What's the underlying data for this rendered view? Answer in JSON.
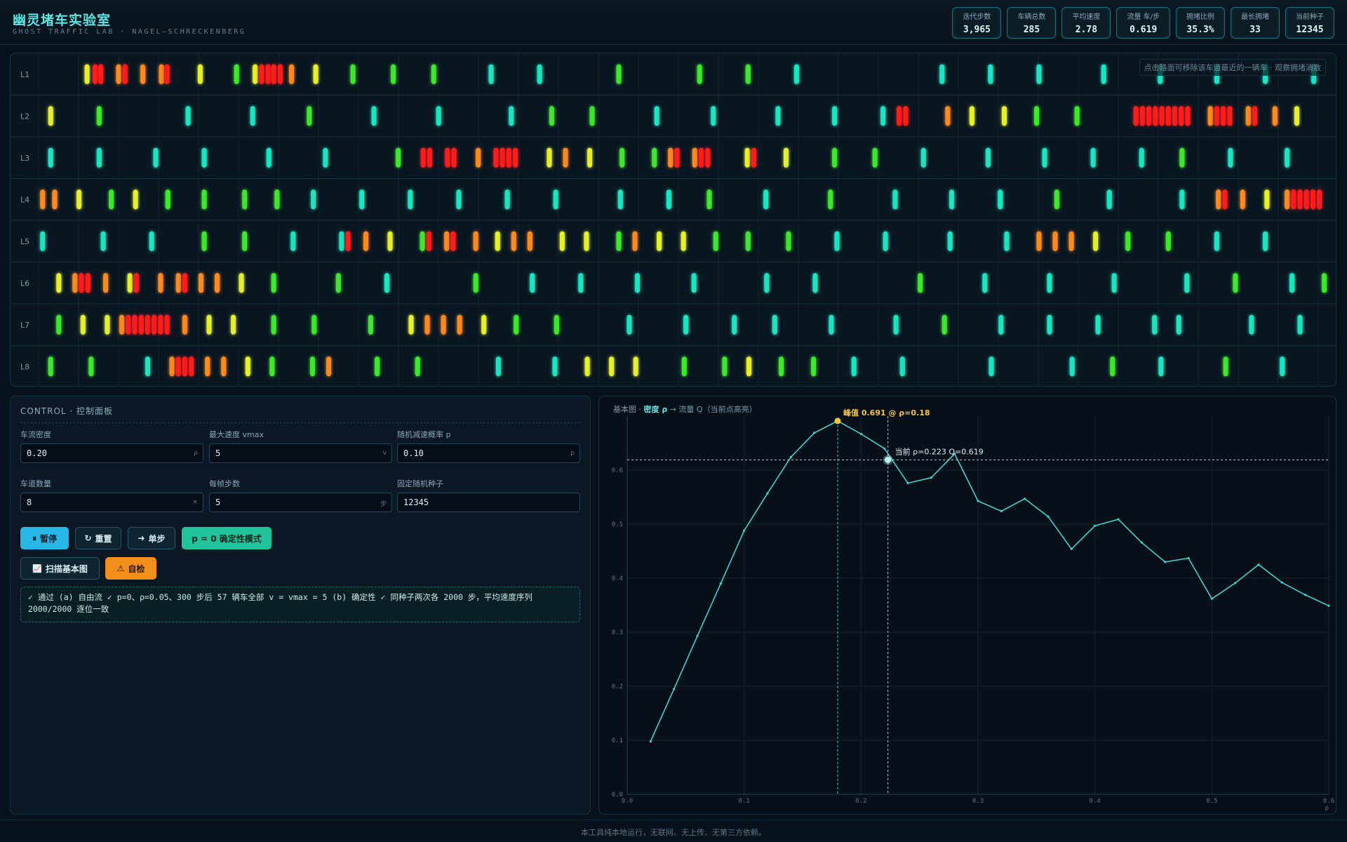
{
  "header": {
    "title": "幽灵堵车实验室",
    "subtitle": "GHOST TRAFFIC LAB · NAGEL–SCHRECKENBERG"
  },
  "stats": [
    {
      "label": "迭代步数",
      "value": "3,965"
    },
    {
      "label": "车辆总数",
      "value": "285"
    },
    {
      "label": "平均速度",
      "value": "2.78"
    },
    {
      "label": "流量 车/步",
      "value": "0.619"
    },
    {
      "label": "拥堵比例",
      "value": "35.3%"
    },
    {
      "label": "最长拥堵",
      "value": "33"
    },
    {
      "label": "当前种子",
      "value": "12345"
    }
  ],
  "road": {
    "hint": "点击路面可移除该车道最近的一辆车 · 观察拥堵消散",
    "lane_labels": [
      "L1",
      "L2",
      "L3",
      "L4",
      "L5",
      "L6",
      "L7",
      "L8"
    ],
    "speed_colors": [
      "#ff1f1f",
      "#ff8a1a",
      "#e6f026",
      "#3de82a",
      "#19e6c1"
    ],
    "cars": [
      [
        [
          60,
          2
        ],
        [
          70,
          0
        ],
        [
          77,
          0
        ],
        [
          99,
          1
        ],
        [
          107,
          0
        ],
        [
          129,
          1
        ],
        [
          152,
          1
        ],
        [
          159,
          0
        ],
        [
          200,
          2
        ],
        [
          245,
          3
        ],
        [
          268,
          2
        ],
        [
          276,
          0
        ],
        [
          284,
          0
        ],
        [
          291,
          0
        ],
        [
          299,
          0
        ],
        [
          313,
          1
        ],
        [
          343,
          2
        ],
        [
          389,
          3
        ],
        [
          439,
          3
        ],
        [
          489,
          3
        ],
        [
          560,
          4
        ],
        [
          620,
          4
        ],
        [
          718,
          3
        ],
        [
          818,
          3
        ],
        [
          878,
          3
        ],
        [
          938,
          4
        ],
        [
          1118,
          4
        ],
        [
          1178,
          4
        ],
        [
          1238,
          4
        ],
        [
          1318,
          4
        ],
        [
          1388,
          4
        ],
        [
          1458,
          4
        ],
        [
          1518,
          4
        ],
        [
          1578,
          4
        ]
      ],
      [
        [
          15,
          2
        ],
        [
          75,
          3
        ],
        [
          185,
          4
        ],
        [
          265,
          4
        ],
        [
          335,
          3
        ],
        [
          415,
          4
        ],
        [
          495,
          4
        ],
        [
          585,
          4
        ],
        [
          635,
          3
        ],
        [
          685,
          3
        ],
        [
          765,
          4
        ],
        [
          835,
          4
        ],
        [
          915,
          4
        ],
        [
          985,
          4
        ],
        [
          1045,
          4
        ],
        [
          1065,
          0
        ],
        [
          1073,
          0
        ],
        [
          1125,
          1
        ],
        [
          1155,
          2
        ],
        [
          1195,
          2
        ],
        [
          1235,
          3
        ],
        [
          1285,
          3
        ],
        [
          1358,
          0
        ],
        [
          1366,
          0
        ],
        [
          1374,
          0
        ],
        [
          1382,
          0
        ],
        [
          1390,
          0
        ],
        [
          1398,
          0
        ],
        [
          1406,
          0
        ],
        [
          1414,
          0
        ],
        [
          1422,
          0
        ],
        [
          1450,
          1
        ],
        [
          1458,
          0
        ],
        [
          1466,
          0
        ],
        [
          1474,
          0
        ],
        [
          1497,
          1
        ],
        [
          1505,
          0
        ],
        [
          1530,
          1
        ],
        [
          1557,
          2
        ]
      ],
      [
        [
          15,
          4
        ],
        [
          75,
          4
        ],
        [
          145,
          4
        ],
        [
          205,
          4
        ],
        [
          285,
          4
        ],
        [
          355,
          4
        ],
        [
          445,
          3
        ],
        [
          476,
          0
        ],
        [
          484,
          0
        ],
        [
          506,
          0
        ],
        [
          514,
          0
        ],
        [
          544,
          1
        ],
        [
          566,
          0
        ],
        [
          574,
          0
        ],
        [
          582,
          0
        ],
        [
          590,
          0
        ],
        [
          632,
          2
        ],
        [
          652,
          1
        ],
        [
          682,
          2
        ],
        [
          722,
          3
        ],
        [
          762,
          3
        ],
        [
          782,
          1
        ],
        [
          790,
          0
        ],
        [
          812,
          1
        ],
        [
          820,
          0
        ],
        [
          828,
          0
        ],
        [
          877,
          2
        ],
        [
          885,
          0
        ],
        [
          925,
          2
        ],
        [
          985,
          3
        ],
        [
          1035,
          3
        ],
        [
          1095,
          4
        ],
        [
          1175,
          4
        ],
        [
          1245,
          4
        ],
        [
          1305,
          4
        ],
        [
          1365,
          4
        ],
        [
          1415,
          3
        ],
        [
          1475,
          4
        ],
        [
          1545,
          4
        ]
      ],
      [
        [
          5,
          1
        ],
        [
          20,
          1
        ],
        [
          50,
          2
        ],
        [
          90,
          3
        ],
        [
          120,
          2
        ],
        [
          160,
          3
        ],
        [
          205,
          3
        ],
        [
          255,
          3
        ],
        [
          295,
          3
        ],
        [
          340,
          4
        ],
        [
          400,
          4
        ],
        [
          460,
          4
        ],
        [
          520,
          4
        ],
        [
          580,
          4
        ],
        [
          640,
          4
        ],
        [
          720,
          4
        ],
        [
          780,
          4
        ],
        [
          830,
          3
        ],
        [
          900,
          4
        ],
        [
          980,
          3
        ],
        [
          1060,
          4
        ],
        [
          1130,
          4
        ],
        [
          1190,
          4
        ],
        [
          1260,
          3
        ],
        [
          1325,
          4
        ],
        [
          1415,
          4
        ],
        [
          1460,
          1
        ],
        [
          1468,
          0
        ],
        [
          1490,
          1
        ],
        [
          1520,
          2
        ],
        [
          1545,
          1
        ],
        [
          1553,
          0
        ],
        [
          1561,
          0
        ],
        [
          1569,
          0
        ],
        [
          1577,
          0
        ],
        [
          1585,
          0
        ]
      ],
      [
        [
          5,
          4
        ],
        [
          80,
          4
        ],
        [
          140,
          4
        ],
        [
          205,
          3
        ],
        [
          255,
          3
        ],
        [
          315,
          4
        ],
        [
          375,
          4
        ],
        [
          383,
          0
        ],
        [
          405,
          1
        ],
        [
          435,
          2
        ],
        [
          475,
          3
        ],
        [
          483,
          0
        ],
        [
          505,
          1
        ],
        [
          513,
          0
        ],
        [
          541,
          1
        ],
        [
          568,
          2
        ],
        [
          588,
          1
        ],
        [
          608,
          1
        ],
        [
          648,
          2
        ],
        [
          678,
          2
        ],
        [
          718,
          3
        ],
        [
          738,
          1
        ],
        [
          768,
          2
        ],
        [
          798,
          2
        ],
        [
          838,
          3
        ],
        [
          878,
          3
        ],
        [
          928,
          3
        ],
        [
          988,
          4
        ],
        [
          1048,
          4
        ],
        [
          1128,
          4
        ],
        [
          1198,
          4
        ],
        [
          1238,
          1
        ],
        [
          1258,
          1
        ],
        [
          1278,
          1
        ],
        [
          1308,
          2
        ],
        [
          1348,
          3
        ],
        [
          1398,
          3
        ],
        [
          1458,
          4
        ],
        [
          1518,
          4
        ]
      ],
      [
        [
          25,
          2
        ],
        [
          45,
          1
        ],
        [
          53,
          0
        ],
        [
          61,
          0
        ],
        [
          83,
          1
        ],
        [
          113,
          2
        ],
        [
          121,
          0
        ],
        [
          151,
          1
        ],
        [
          173,
          1
        ],
        [
          181,
          0
        ],
        [
          201,
          1
        ],
        [
          221,
          1
        ],
        [
          251,
          2
        ],
        [
          291,
          3
        ],
        [
          371,
          3
        ],
        [
          431,
          4
        ],
        [
          541,
          3
        ],
        [
          611,
          4
        ],
        [
          671,
          4
        ],
        [
          741,
          4
        ],
        [
          811,
          4
        ],
        [
          901,
          4
        ],
        [
          961,
          4
        ],
        [
          1091,
          3
        ],
        [
          1171,
          4
        ],
        [
          1251,
          4
        ],
        [
          1331,
          4
        ],
        [
          1421,
          4
        ],
        [
          1481,
          3
        ],
        [
          1551,
          4
        ],
        [
          1591,
          3
        ]
      ],
      [
        [
          25,
          3
        ],
        [
          55,
          2
        ],
        [
          85,
          2
        ],
        [
          103,
          1
        ],
        [
          111,
          0
        ],
        [
          119,
          0
        ],
        [
          127,
          0
        ],
        [
          135,
          0
        ],
        [
          143,
          0
        ],
        [
          151,
          0
        ],
        [
          159,
          0
        ],
        [
          181,
          1
        ],
        [
          211,
          2
        ],
        [
          241,
          2
        ],
        [
          291,
          3
        ],
        [
          341,
          3
        ],
        [
          411,
          3
        ],
        [
          461,
          2
        ],
        [
          481,
          1
        ],
        [
          501,
          1
        ],
        [
          521,
          1
        ],
        [
          551,
          2
        ],
        [
          591,
          3
        ],
        [
          641,
          3
        ],
        [
          731,
          4
        ],
        [
          801,
          4
        ],
        [
          861,
          4
        ],
        [
          911,
          4
        ],
        [
          981,
          4
        ],
        [
          1061,
          4
        ],
        [
          1121,
          3
        ],
        [
          1191,
          4
        ],
        [
          1251,
          4
        ],
        [
          1311,
          4
        ],
        [
          1381,
          4
        ],
        [
          1411,
          4
        ],
        [
          1501,
          4
        ],
        [
          1561,
          4
        ]
      ],
      [
        [
          15,
          3
        ],
        [
          65,
          3
        ],
        [
          135,
          4
        ],
        [
          165,
          1
        ],
        [
          173,
          0
        ],
        [
          181,
          0
        ],
        [
          189,
          0
        ],
        [
          209,
          1
        ],
        [
          229,
          1
        ],
        [
          259,
          2
        ],
        [
          289,
          3
        ],
        [
          339,
          3
        ],
        [
          359,
          1
        ],
        [
          419,
          3
        ],
        [
          469,
          3
        ],
        [
          569,
          4
        ],
        [
          639,
          4
        ],
        [
          679,
          2
        ],
        [
          709,
          2
        ],
        [
          739,
          2
        ],
        [
          799,
          3
        ],
        [
          849,
          3
        ],
        [
          879,
          2
        ],
        [
          919,
          3
        ],
        [
          959,
          3
        ],
        [
          1009,
          4
        ],
        [
          1069,
          4
        ],
        [
          1179,
          4
        ],
        [
          1279,
          4
        ],
        [
          1329,
          3
        ],
        [
          1389,
          4
        ],
        [
          1469,
          3
        ],
        [
          1539,
          4
        ]
      ]
    ]
  },
  "controls": {
    "panel_title": "CONTROL · 控制面板",
    "fields": [
      {
        "label": "车流密度",
        "value": "0.20",
        "unit": "ρ"
      },
      {
        "label": "最大速度 vmax",
        "value": "5",
        "unit": "v"
      },
      {
        "label": "随机减速概率 p",
        "value": "0.10",
        "unit": "p"
      },
      {
        "label": "车道数量",
        "value": "8",
        "unit": "×"
      },
      {
        "label": "每帧步数",
        "value": "5",
        "unit": "步"
      },
      {
        "label": "固定随机种子",
        "value": "12345",
        "unit": ""
      }
    ],
    "buttons": {
      "pause": "暂停",
      "pause_icon": "⏸",
      "reset": "重置",
      "reset_icon": "↻",
      "step": "单步",
      "step_icon": "➜",
      "deterministic": "p = 0 确定性模式",
      "sweep": "扫描基本图",
      "sweep_icon": "📈",
      "selfcheck": "自检",
      "selfcheck_icon": "⚠"
    },
    "result_text": "✓ 通过 (a) 自由流 ✓ p=0、ρ=0.05、300 步后 57 辆车全部 v = vmax = 5 (b) 确定性 ✓ 同种子两次各 2000 步，平均速度序列 2000/2000 逐位一致"
  },
  "chart_data": {
    "type": "line",
    "title_prefix": "基本图 · ",
    "title_bold": "密度 ρ",
    "title_suffix": " → 流量 Q（当前点高亮）",
    "xlabel": "ρ",
    "xlim": [
      0,
      0.6
    ],
    "ylim": [
      0,
      0.7
    ],
    "xticks": [
      "0.0",
      "0.1",
      "0.2",
      "0.3",
      "0.4",
      "0.5",
      "0.6"
    ],
    "yticks": [
      "0.0",
      "0.1",
      "0.2",
      "0.3",
      "0.4",
      "0.5",
      "0.6"
    ],
    "x": [
      0.02,
      0.04,
      0.06,
      0.08,
      0.1,
      0.12,
      0.14,
      0.16,
      0.18,
      0.2,
      0.22,
      0.24,
      0.26,
      0.28,
      0.3,
      0.32,
      0.34,
      0.36,
      0.38,
      0.4,
      0.42,
      0.44,
      0.46,
      0.48,
      0.5,
      0.52,
      0.54,
      0.56,
      0.58,
      0.6
    ],
    "y": [
      0.098,
      0.195,
      0.293,
      0.39,
      0.488,
      0.557,
      0.624,
      0.669,
      0.691,
      0.667,
      0.64,
      0.576,
      0.586,
      0.63,
      0.543,
      0.524,
      0.547,
      0.514,
      0.454,
      0.497,
      0.509,
      0.466,
      0.43,
      0.437,
      0.362,
      0.391,
      0.425,
      0.392,
      0.369,
      0.349
    ],
    "peak": {
      "x": 0.18,
      "y": 0.691,
      "label": "峰值 0.691 @ ρ=0.18"
    },
    "current": {
      "x": 0.223,
      "y": 0.619,
      "label": "当前 ρ=0.223  Q=0.619"
    },
    "colors": {
      "line": "#3fd3c9",
      "peak": "#f5c542",
      "current": "#bff3f6",
      "grid": "#14232d"
    }
  },
  "footer": "本工具纯本地运行，无联网、无上传、无第三方依赖。"
}
